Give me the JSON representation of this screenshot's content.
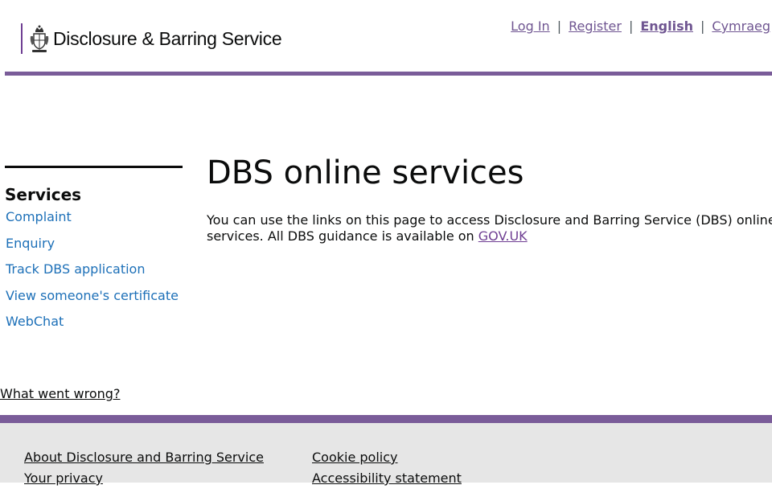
{
  "header": {
    "brand": "Disclosure & Barring Service",
    "links": {
      "login": "Log In",
      "register": "Register",
      "english": "English",
      "cymraeg": "Cymraeg"
    },
    "separator": "|"
  },
  "sidebar": {
    "heading": "Services",
    "items": [
      {
        "label": "Complaint"
      },
      {
        "label": "Enquiry"
      },
      {
        "label": "Track DBS application"
      },
      {
        "label": "View someone's certificate"
      },
      {
        "label": "WebChat"
      }
    ]
  },
  "main": {
    "title": "DBS online services",
    "intro_text": "You can use the links on this page to access Disclosure and Barring Service (DBS) online services. All DBS guidance is available on ",
    "intro_link": "GOV.UK"
  },
  "feedback_link": "What went wrong?",
  "footer": {
    "col1": [
      "About Disclosure and Barring Service",
      "Your privacy"
    ],
    "col2": [
      "Cookie policy",
      "Accessibility statement"
    ]
  },
  "colors": {
    "accent_purple": "#7a5c99",
    "link_blue": "#1d70b8",
    "header_link": "#6f5591"
  }
}
